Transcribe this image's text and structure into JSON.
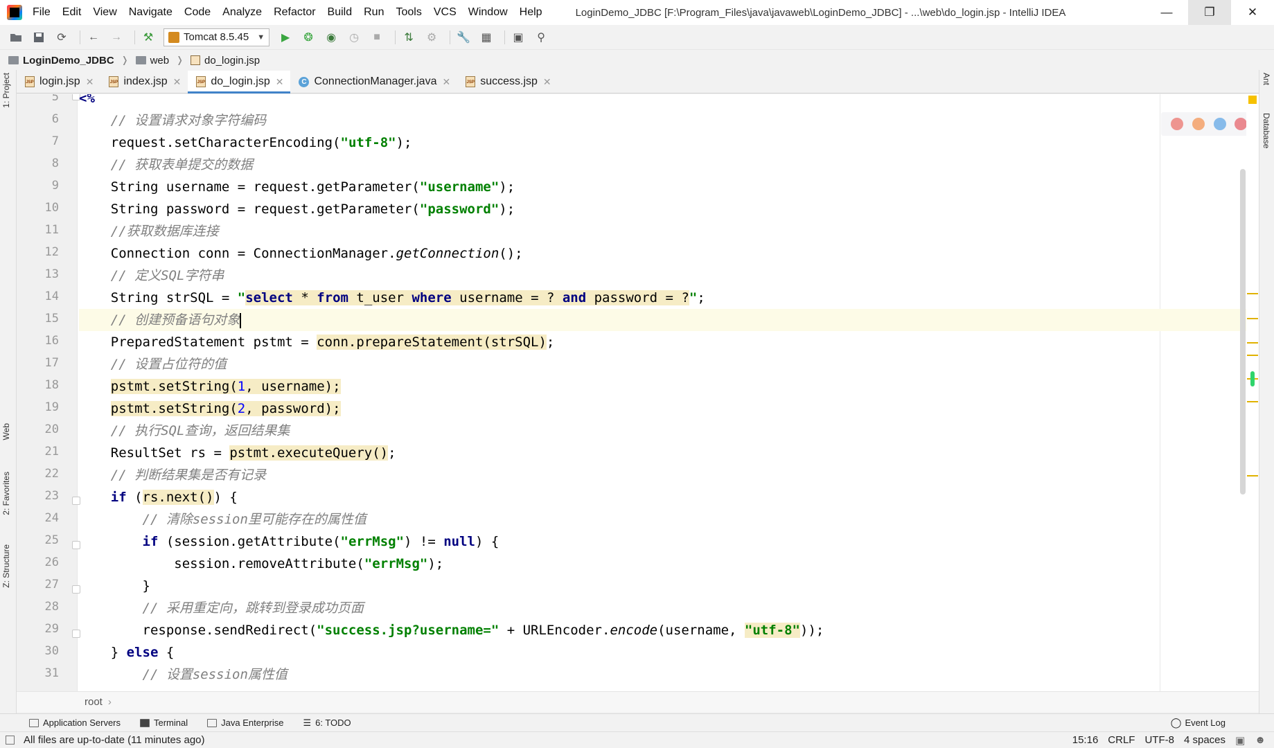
{
  "window": {
    "title": "LoginDemo_JDBC [F:\\Program_Files\\java\\javaweb\\LoginDemo_JDBC] - ...\\web\\do_login.jsp - IntelliJ IDEA",
    "menu": [
      "File",
      "Edit",
      "View",
      "Navigate",
      "Code",
      "Analyze",
      "Refactor",
      "Build",
      "Run",
      "Tools",
      "VCS",
      "Window",
      "Help"
    ]
  },
  "toolbar": {
    "run_config": "Tomcat 8.5.45"
  },
  "navbar": {
    "project": "LoginDemo_JDBC",
    "folder": "web",
    "file": "do_login.jsp"
  },
  "tabs": [
    {
      "label": "login.jsp",
      "kind": "jsp"
    },
    {
      "label": "index.jsp",
      "kind": "jsp"
    },
    {
      "label": "do_login.jsp",
      "kind": "jsp",
      "active": true
    },
    {
      "label": "ConnectionManager.java",
      "kind": "class"
    },
    {
      "label": "success.jsp",
      "kind": "jsp"
    }
  ],
  "left_tools": {
    "project": "1: Project",
    "web": "Web",
    "favorites": "2: Favorites",
    "structure": "Z: Structure"
  },
  "right_tools": {
    "ant": "Ant",
    "database": "Database"
  },
  "editor": {
    "line_numbers": [
      "5",
      "6",
      "7",
      "8",
      "9",
      "10",
      "11",
      "12",
      "13",
      "14",
      "15",
      "16",
      "17",
      "18",
      "19",
      "20",
      "21",
      "22",
      "23",
      "24",
      "25",
      "26",
      "27",
      "28",
      "29",
      "30",
      "31"
    ],
    "current_line": "15",
    "breadcrumb": "root"
  },
  "toolwindows": {
    "app_servers": "Application Servers",
    "terminal": "Terminal",
    "java_ee": "Java Enterprise",
    "todo": "6: TODO",
    "event_log": "Event Log"
  },
  "status": {
    "message": "All files are up-to-date (11 minutes ago)",
    "position": "15:16",
    "line_sep": "CRLF",
    "encoding": "UTF-8",
    "indent": "4 spaces"
  },
  "colors": {
    "accent": "#4083c9",
    "keyword": "#000080",
    "string": "#008000",
    "comment": "#808080",
    "highlight": "#f6ecc5"
  }
}
